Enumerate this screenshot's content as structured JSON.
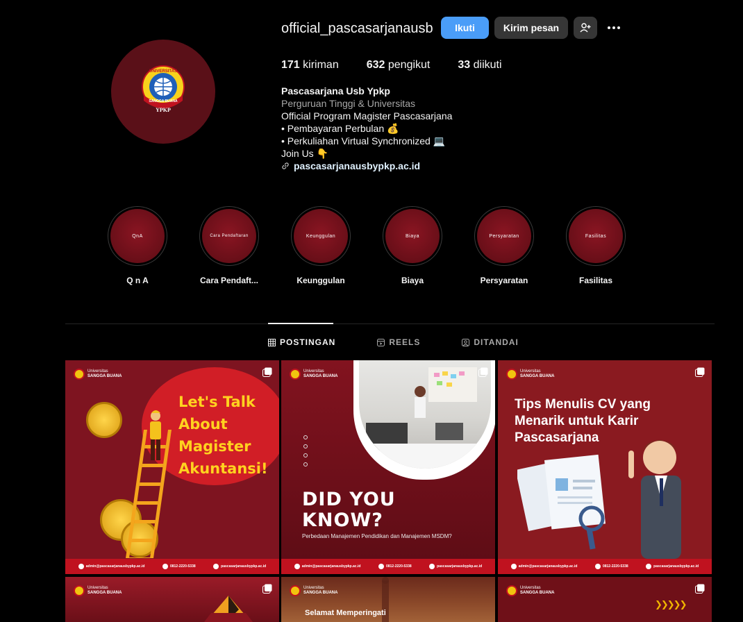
{
  "profile": {
    "username": "official_pascasarjanausb",
    "follow_label": "Ikuti",
    "message_label": "Kirim pesan",
    "stats": {
      "posts_count": "171",
      "posts_label": "kiriman",
      "followers_count": "632",
      "followers_label": "pengikut",
      "following_count": "33",
      "following_label": "diikuti"
    },
    "bio": {
      "name": "Pascasarjana Usb Ypkp",
      "category": "Perguruan Tinggi & Universitas",
      "line1": "Official Program Magister Pascasarjana",
      "line2": "• Pembayaran Perbulan 💰",
      "line3": "• Perkuliahan Virtual Synchronized 💻",
      "line4": "Join Us 👇",
      "link": "pascasarjanausbypkp.ac.id"
    },
    "avatar": {
      "logo_top_text": "UNIVERSITAS",
      "logo_band_text": "SANGGA BUANA",
      "logo_bottom_text": "YPKP"
    }
  },
  "highlights": [
    {
      "cover_text": "QnA",
      "label": "Q n A"
    },
    {
      "cover_text": "Cara Pendaftaran",
      "label": "Cara Pendaft..."
    },
    {
      "cover_text": "Keunggulan",
      "label": "Keunggulan"
    },
    {
      "cover_text": "Biaya",
      "label": "Biaya"
    },
    {
      "cover_text": "Persyaratan",
      "label": "Persyaratan"
    },
    {
      "cover_text": "Fasilitas",
      "label": "Fasilitas"
    }
  ],
  "tabs": [
    {
      "label": "POSTINGAN",
      "icon": "grid-icon"
    },
    {
      "label": "REELS",
      "icon": "reels-icon"
    },
    {
      "label": "DITANDAI",
      "icon": "tagged-icon"
    }
  ],
  "posts": {
    "brand_small": "Universitas",
    "brand_big": "SANGGA BUANA",
    "footer_email": "admin@pascasarjanausbypkp.ac.id",
    "footer_phone": "0812-2220-5338",
    "footer_web": "pascasarjanausbypkp.ac.id",
    "post1": {
      "line1": "Let's Talk",
      "line2": "About",
      "line3": "Magister",
      "line4": "Akuntansi!"
    },
    "post2": {
      "line1": "DID YOU",
      "line2": "KNOW?",
      "sub": "Perbedaan Manajemen Pendidikan dan Manajemen MSDM?"
    },
    "post3": {
      "headline": "Tips Menulis CV yang Menarik untuk Karir Pascasarjana"
    },
    "post5": {
      "greet": "Selamat Memperingati"
    }
  },
  "colors": {
    "accent_blue": "#4a9df8",
    "brand_red": "#c0121f",
    "brand_yellow": "#ffd21f"
  }
}
